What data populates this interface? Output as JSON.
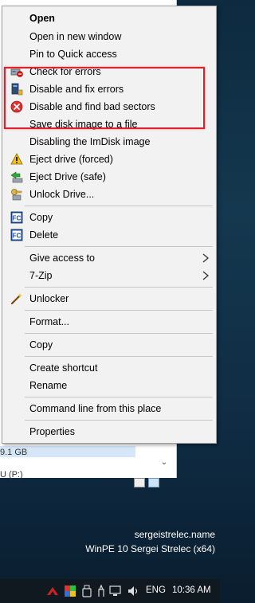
{
  "menu": {
    "open": "Open",
    "open_new_window": "Open in new window",
    "pin_quick_access": "Pin to Quick access",
    "check_errors": "Check for errors",
    "disable_fix_errors": "Disable and fix errors",
    "disable_find_bad_sectors": "Disable and find bad sectors",
    "save_disk_image": "Save disk image to a file",
    "disabling_imdisk": "Disabling the ImDisk image",
    "eject_forced": "Eject drive (forced)",
    "eject_safe": "Eject Drive (safe)",
    "unlock_drive": "Unlock Drive...",
    "copy_fc": "Copy",
    "delete_fc": "Delete",
    "give_access": "Give access to",
    "seven_zip": "7-Zip",
    "unlocker": "Unlocker",
    "format": "Format...",
    "copy": "Copy",
    "create_shortcut": "Create shortcut",
    "rename": "Rename",
    "command_line": "Command line from this place",
    "properties": "Properties"
  },
  "explorer": {
    "size_text": "9.1 GB",
    "drive_text": "U (P:)"
  },
  "desktop": {
    "watermark_line1": "sergeistrelec.name",
    "watermark_line2": "WinPE 10 Sergei Strelec (x64)"
  },
  "taskbar": {
    "language": "ENG",
    "time": "10:36 AM"
  },
  "colors": {
    "highlight_border": "#e0202a",
    "menu_bg": "#f2f2f2"
  }
}
